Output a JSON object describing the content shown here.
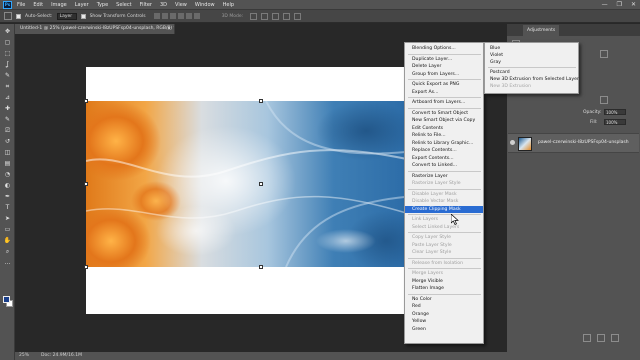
{
  "app": {
    "logo": "Ps",
    "menu": [
      "File",
      "Edit",
      "Image",
      "Layer",
      "Type",
      "Select",
      "Filter",
      "3D",
      "View",
      "Window",
      "Help"
    ],
    "window_controls": [
      "—",
      "❐",
      "✕"
    ]
  },
  "options_bar": {
    "auto_select_label": "Auto-Select:",
    "auto_select_value": "Layer",
    "show_transform_label": "Show Transform Controls",
    "mode_label": "3D Mode:"
  },
  "document": {
    "tab_title": "Untitled-1 @ 25% (pawel-czerwinski-l8zUPSFsp04-unsplash, RGB/8) *",
    "tab_close": "×"
  },
  "status": {
    "zoom": "25%",
    "doc_size": "Doc: 24.9M/16.1M"
  },
  "panels": {
    "adjustments_tab": "Adjustments",
    "opacity_label": "Opacity:",
    "opacity_value": "100%",
    "fill_label": "Fill:",
    "fill_value": "100%",
    "layer_name": "pawel-czerwinski-l8zUPSFsp04-unsplash"
  },
  "context_menu": {
    "items": [
      {
        "label": "Blending Options...",
        "enabled": true
      },
      {
        "sep": true
      },
      {
        "label": "Duplicate Layer...",
        "enabled": true
      },
      {
        "label": "Delete Layer",
        "enabled": true
      },
      {
        "label": "Group from Layers...",
        "enabled": true
      },
      {
        "sep": true
      },
      {
        "label": "Quick Export as PNG",
        "enabled": true
      },
      {
        "label": "Export As...",
        "enabled": true
      },
      {
        "sep": true
      },
      {
        "label": "Artboard from Layers...",
        "enabled": true
      },
      {
        "sep": true
      },
      {
        "label": "Convert to Smart Object",
        "enabled": true
      },
      {
        "label": "New Smart Object via Copy",
        "enabled": true
      },
      {
        "label": "Edit Contents",
        "enabled": true
      },
      {
        "label": "Relink to File...",
        "enabled": true
      },
      {
        "label": "Relink to Library Graphic...",
        "enabled": true
      },
      {
        "label": "Replace Contents...",
        "enabled": true
      },
      {
        "label": "Export Contents...",
        "enabled": true
      },
      {
        "label": "Convert to Linked...",
        "enabled": true
      },
      {
        "sep": true
      },
      {
        "label": "Rasterize Layer",
        "enabled": true
      },
      {
        "label": "Rasterize Layer Style",
        "enabled": false
      },
      {
        "sep": true
      },
      {
        "label": "Disable Layer Mask",
        "enabled": false
      },
      {
        "label": "Disable Vector Mask",
        "enabled": false
      },
      {
        "label": "Create Clipping Mask",
        "enabled": true,
        "highlighted": true
      },
      {
        "sep": true
      },
      {
        "label": "Link Layers",
        "enabled": false
      },
      {
        "label": "Select Linked Layers",
        "enabled": false
      },
      {
        "sep": true
      },
      {
        "label": "Copy Layer Style",
        "enabled": false
      },
      {
        "label": "Paste Layer Style",
        "enabled": false
      },
      {
        "label": "Clear Layer Style",
        "enabled": false
      },
      {
        "sep": true
      },
      {
        "label": "Release from Isolation",
        "enabled": false
      },
      {
        "sep": true
      },
      {
        "label": "Merge Layers",
        "enabled": false
      },
      {
        "label": "Merge Visible",
        "enabled": true
      },
      {
        "label": "Flatten Image",
        "enabled": true
      },
      {
        "sep": true
      },
      {
        "label": "No Color",
        "enabled": true
      },
      {
        "label": "Red",
        "enabled": true
      },
      {
        "label": "Orange",
        "enabled": true
      },
      {
        "label": "Yellow",
        "enabled": true
      },
      {
        "label": "Green",
        "enabled": true
      }
    ]
  },
  "submenu": {
    "items": [
      {
        "label": "Blue",
        "enabled": true
      },
      {
        "label": "Violet",
        "enabled": true
      },
      {
        "label": "Gray",
        "enabled": true
      },
      {
        "sep": true
      },
      {
        "label": "Postcard",
        "enabled": true
      },
      {
        "label": "New 3D Extrusion from Selected Layer",
        "enabled": true
      },
      {
        "label": "New 3D Extrusion",
        "enabled": false
      }
    ]
  },
  "colors": {
    "highlight": "#2a6cd2",
    "foreground": "#1a3f8a",
    "background": "#ffffff"
  },
  "toolbar": {
    "tools": [
      "move-tool",
      "artboard-tool",
      "marquee-tool",
      "lasso-tool",
      "quick-select-tool",
      "crop-tool",
      "eyedropper-tool",
      "healing-brush-tool",
      "brush-tool",
      "clone-stamp-tool",
      "history-brush-tool",
      "eraser-tool",
      "gradient-tool",
      "blur-tool",
      "dodge-tool",
      "pen-tool",
      "type-tool",
      "path-select-tool",
      "rectangle-tool",
      "hand-tool",
      "zoom-tool",
      "edit-toolbar"
    ]
  }
}
